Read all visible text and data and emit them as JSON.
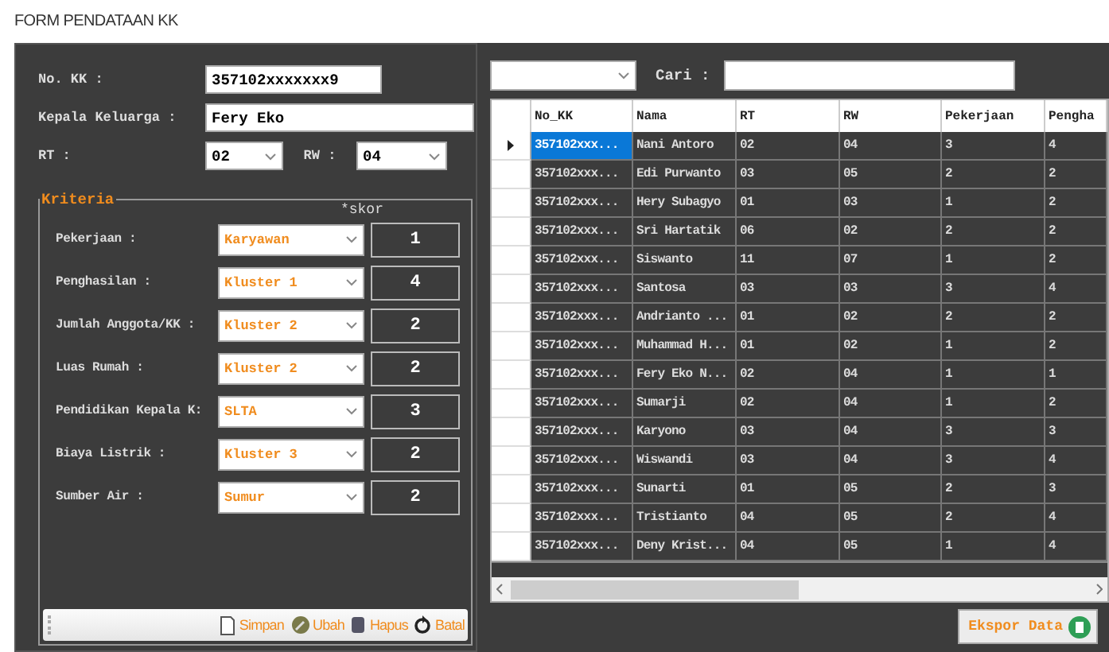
{
  "window": {
    "title": "FORM PENDATAAN KK"
  },
  "form": {
    "no_kk": {
      "label": "No. KK :",
      "value": "357102xxxxxxx9"
    },
    "kepala": {
      "label": "Kepala Keluarga :",
      "value": "Fery Eko"
    },
    "rt": {
      "label": "RT :",
      "value": "02"
    },
    "rw": {
      "label": "RW :",
      "value": "04"
    }
  },
  "kriteria": {
    "title": "Kriteria",
    "skor_label": "*skor",
    "items": [
      {
        "label": "Pekerjaan :",
        "value": "Karyawan",
        "score": "1"
      },
      {
        "label": "Penghasilan :",
        "value": "Kluster 1",
        "score": "4"
      },
      {
        "label": "Jumlah Anggota/KK :",
        "value": "Kluster 2",
        "score": "2"
      },
      {
        "label": "Luas Rumah :",
        "value": "Kluster 2",
        "score": "2"
      },
      {
        "label": "Pendidikan Kepala K:",
        "value": "SLTA",
        "score": "3"
      },
      {
        "label": "Biaya Listrik :",
        "value": "Kluster 3",
        "score": "2"
      },
      {
        "label": "Sumber Air :",
        "value": "Sumur",
        "score": "2"
      }
    ]
  },
  "toolbar": [
    {
      "kind": "save",
      "label": "Simpan"
    },
    {
      "kind": "edit",
      "label": "Ubah"
    },
    {
      "kind": "delete",
      "label": "Hapus"
    },
    {
      "kind": "cancel",
      "label": "Batal"
    }
  ],
  "search": {
    "label": "Cari :"
  },
  "table": {
    "columns": [
      "No_KK",
      "Nama",
      "RT",
      "RW",
      "Pekerjaan",
      "Pengha"
    ],
    "rows": [
      {
        "selected": true,
        "cells": [
          "357102xxx...",
          "Nani Antoro",
          "02",
          "04",
          "3",
          "4"
        ]
      },
      {
        "selected": false,
        "cells": [
          "357102xxx...",
          "Edi Purwanto",
          "03",
          "05",
          "2",
          "2"
        ]
      },
      {
        "selected": false,
        "cells": [
          "357102xxx...",
          "Hery Subagyo",
          "01",
          "03",
          "1",
          "2"
        ]
      },
      {
        "selected": false,
        "cells": [
          "357102xxx...",
          "Sri Hartatik",
          "06",
          "02",
          "2",
          "2"
        ]
      },
      {
        "selected": false,
        "cells": [
          "357102xxx...",
          "Siswanto",
          "11",
          "07",
          "1",
          "2"
        ]
      },
      {
        "selected": false,
        "cells": [
          "357102xxx...",
          "Santosa",
          "03",
          "03",
          "3",
          "4"
        ]
      },
      {
        "selected": false,
        "cells": [
          "357102xxx...",
          "Andrianto ...",
          "01",
          "02",
          "2",
          "2"
        ]
      },
      {
        "selected": false,
        "cells": [
          "357102xxx...",
          "Muhammad H...",
          "01",
          "02",
          "1",
          "2"
        ]
      },
      {
        "selected": false,
        "cells": [
          "357102xxx...",
          "Fery Eko N...",
          "02",
          "04",
          "1",
          "1"
        ]
      },
      {
        "selected": false,
        "cells": [
          "357102xxx...",
          "Sumarji",
          "02",
          "04",
          "1",
          "2"
        ]
      },
      {
        "selected": false,
        "cells": [
          "357102xxx...",
          "Karyono",
          "03",
          "04",
          "3",
          "3"
        ]
      },
      {
        "selected": false,
        "cells": [
          "357102xxx...",
          "Wiswandi",
          "03",
          "04",
          "3",
          "4"
        ]
      },
      {
        "selected": false,
        "cells": [
          "357102xxx...",
          "Sunarti",
          "01",
          "05",
          "2",
          "3"
        ]
      },
      {
        "selected": false,
        "cells": [
          "357102xxx...",
          "Tristianto",
          "04",
          "05",
          "2",
          "4"
        ]
      },
      {
        "selected": false,
        "cells": [
          "357102xxx...",
          "Deny Krist...",
          "04",
          "05",
          "1",
          "4"
        ]
      }
    ]
  },
  "export_button": {
    "label": "Ekspor Data"
  }
}
